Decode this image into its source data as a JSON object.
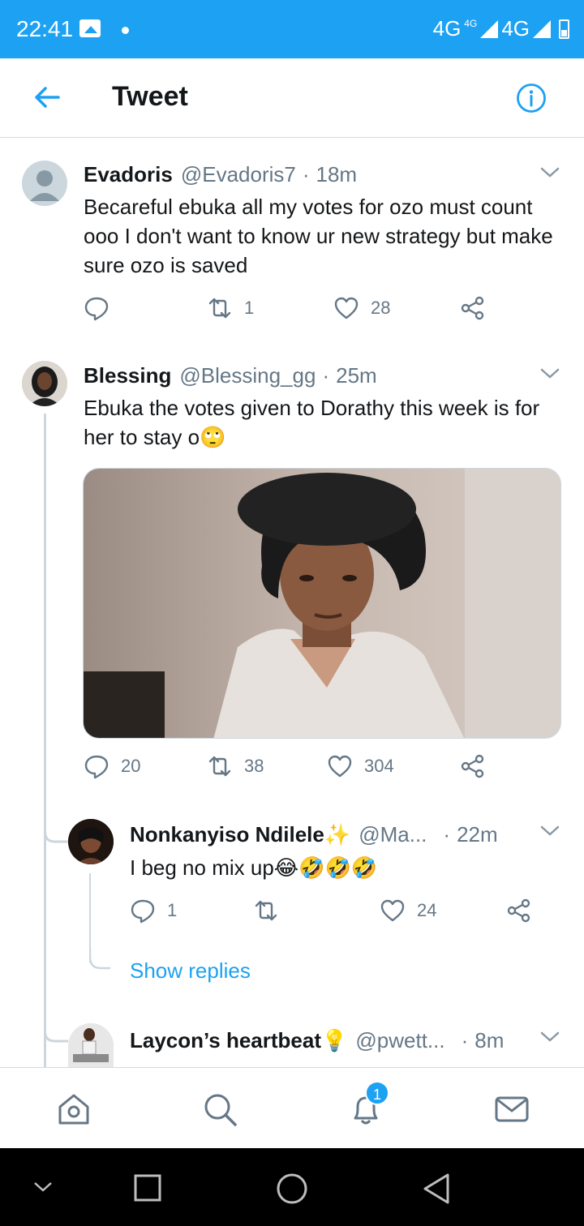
{
  "status_bar": {
    "time": "22:41",
    "network": "4G",
    "network_sup": "4G",
    "network2": "4G"
  },
  "header": {
    "title": "Tweet"
  },
  "tweets": [
    {
      "name": "Evadoris",
      "handle": "@Evadoris7",
      "sep": "·",
      "time": "18m",
      "text": "Becareful ebuka all my votes for ozo must count ooo I don't want to know ur new strategy but make sure ozo is saved",
      "replies": "",
      "retweets": "1",
      "likes": "28"
    },
    {
      "name": "Blessing",
      "handle": "@Blessing_gg",
      "sep": "·",
      "time": "25m",
      "text": "Ebuka the votes given to Dorathy this week is for her to stay o🙄",
      "replies": "20",
      "retweets": "38",
      "likes": "304"
    },
    {
      "name": "Nonkanyiso Ndilele✨",
      "handle": "@Ma...",
      "sep": "·",
      "time": "22m",
      "text": "I beg no mix up😂🤣🤣🤣",
      "replies": "1",
      "retweets": "",
      "likes": "24"
    },
    {
      "name": "Laycon’s heartbeat💡",
      "handle": "@pwett...",
      "sep": "·",
      "time": "8m"
    }
  ],
  "show_replies": "Show replies",
  "bottom_nav": {
    "notification_count": "1"
  },
  "colors": {
    "accent": "#1da1f2",
    "muted": "#657786",
    "divider": "#d6d9db"
  }
}
